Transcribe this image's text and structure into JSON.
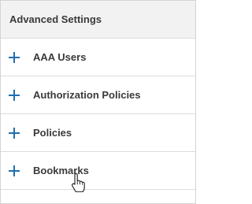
{
  "panel": {
    "title": "Advanced Settings",
    "items": [
      {
        "label": "AAA Users",
        "icon": "plus-icon"
      },
      {
        "label": "Authorization Policies",
        "icon": "plus-icon"
      },
      {
        "label": "Policies",
        "icon": "plus-icon"
      },
      {
        "label": "Bookmarks",
        "icon": "plus-icon"
      }
    ]
  },
  "colors": {
    "accent": "#1f6fb2",
    "text": "#3a3a3a",
    "header_bg": "#f2f2f2",
    "border": "#dcdcdc"
  },
  "cursor": {
    "icon": "hand-pointer-icon"
  }
}
